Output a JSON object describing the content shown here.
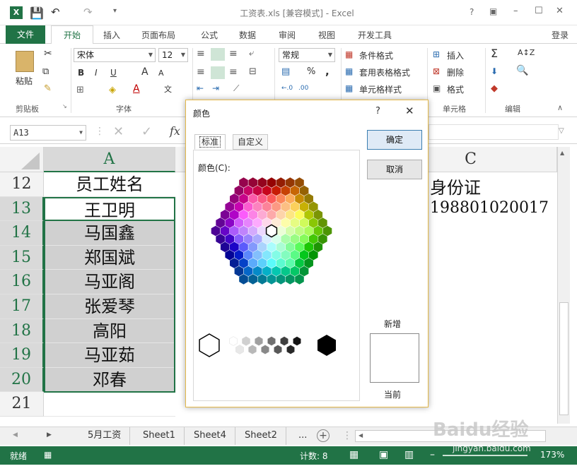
{
  "window": {
    "title": "工资表.xls [兼容模式] - Excel",
    "controls": [
      "?",
      "▣",
      "–",
      "☐",
      "✕"
    ]
  },
  "ribbon_tabs": {
    "file": "文件",
    "items": [
      "开始",
      "插入",
      "页面布局",
      "公式",
      "数据",
      "审阅",
      "视图",
      "开发工具"
    ],
    "login": "登录"
  },
  "ribbon": {
    "clipboard": {
      "paste": "粘贴",
      "label": "剪贴板"
    },
    "font": {
      "name": "宋体",
      "size": "12",
      "bold": "B",
      "italic": "I",
      "underline": "U",
      "grow": "A",
      "shrink": "A",
      "wen": "文",
      "label": "字体"
    },
    "number": {
      "format": "常规",
      "percent": "%",
      "comma": ",",
      "dec_inc": "←.0",
      "dec_dec": ".00"
    },
    "styles": [
      "条件格式",
      "套用表格格式",
      "单元格样式"
    ],
    "cells": {
      "items": [
        "插入",
        "删除",
        "格式"
      ],
      "label": "单元格"
    },
    "editing": {
      "label": "编辑"
    }
  },
  "formula_bar": {
    "name_box": "A13",
    "fx": "fx"
  },
  "sheet": {
    "columns": [
      "A",
      "C"
    ],
    "rows": [
      "12",
      "13",
      "14",
      "15",
      "16",
      "17",
      "18",
      "19",
      "20",
      "21"
    ],
    "colA": [
      "员工姓名",
      "王卫明",
      "马国鑫",
      "郑国斌",
      "马亚阁",
      "张爱琴",
      "高阳",
      "马亚茹",
      "邓春",
      ""
    ],
    "colC": [
      "身份证",
      "198801020017"
    ]
  },
  "sheet_tabs": [
    "5月工资",
    "Sheet1",
    "Sheet4",
    "Sheet2",
    "..."
  ],
  "status": {
    "mode": "就绪",
    "count": "计数: 8",
    "zoom": "173%"
  },
  "dialog": {
    "title": "颜色",
    "help": "?",
    "close": "✕",
    "tabs": [
      "标准",
      "自定义"
    ],
    "colors_label": "颜色(C):",
    "ok": "确定",
    "cancel": "取消",
    "new_label": "新增",
    "current_label": "当前"
  },
  "watermark": "Baidu经验",
  "watermark_url": "jingyan.baidu.com"
}
